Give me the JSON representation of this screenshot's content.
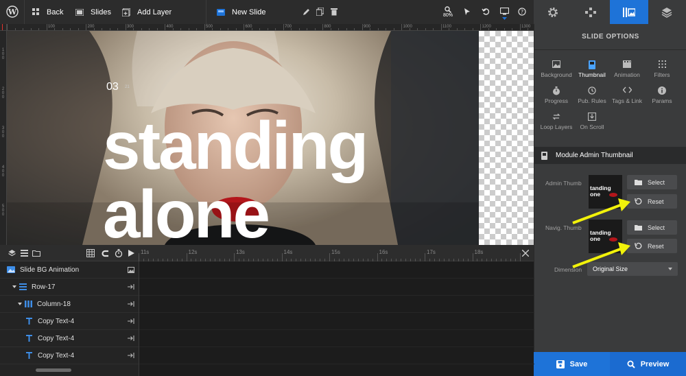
{
  "topbar": {
    "back_label": "Back",
    "slides_label": "Slides",
    "add_layer_label": "Add Layer",
    "slide_name": "New Slide",
    "zoom": "80%"
  },
  "ruler": {
    "h_marks": [
      "100",
      "200",
      "300",
      "400",
      "500",
      "600",
      "700",
      "800",
      "900",
      "1000",
      "1100",
      "1200",
      "1300"
    ],
    "v_marks": [
      "100",
      "200",
      "300",
      "400",
      "500"
    ]
  },
  "canvas": {
    "slide_number": "03",
    "slide_number_small": "21",
    "headline_1": "standing",
    "headline_2": "alone",
    "colors": {
      "accent_lip": "#b3161b"
    }
  },
  "timeline": {
    "ticks": [
      "11s",
      "12s",
      "13s",
      "14s",
      "15s",
      "16s",
      "17s",
      "18s"
    ],
    "layers": [
      {
        "label": "Slide BG Animation",
        "icon": "image-icon"
      },
      {
        "label": "Row-17",
        "icon": "row-icon"
      },
      {
        "label": "Column-18",
        "icon": "column-icon"
      },
      {
        "label": "Copy Text-4",
        "icon": "text-t-icon"
      },
      {
        "label": "Copy Text-4",
        "icon": "text-t-icon"
      },
      {
        "label": "Copy Text-4",
        "icon": "text-t-icon"
      }
    ]
  },
  "panel": {
    "title": "SLIDE OPTIONS",
    "options": [
      {
        "label": "Background",
        "icon": "image-icon"
      },
      {
        "label": "Thumbnail",
        "icon": "thumbnail-icon",
        "active": true
      },
      {
        "label": "Animation",
        "icon": "film-icon"
      },
      {
        "label": "Filters",
        "icon": "filters-icon"
      },
      {
        "label": "Progress",
        "icon": "stopwatch-icon"
      },
      {
        "label": "Pub. Rules",
        "icon": "clock-icon"
      },
      {
        "label": "Tags & Link",
        "icon": "code-icon"
      },
      {
        "label": "Params",
        "icon": "info-icon"
      },
      {
        "label": "Loop Layers",
        "icon": "loop-icon"
      },
      {
        "label": "On Scroll",
        "icon": "scroll-icon"
      }
    ],
    "section_title": "Module Admin Thumbnail",
    "admin_thumb_label": "Admin Thumb",
    "navig_thumb_label": "Navig. Thumb",
    "thumb_text_1": "tanding",
    "thumb_text_2": "one",
    "select_label": "Select",
    "reset_label": "Reset",
    "dimension_label": "Dimension",
    "dimension_value": "Original Size"
  },
  "footer": {
    "save_label": "Save",
    "preview_label": "Preview"
  },
  "colors": {
    "accent": "#1e73d8",
    "annotation_arrow": "#f2f20a"
  }
}
